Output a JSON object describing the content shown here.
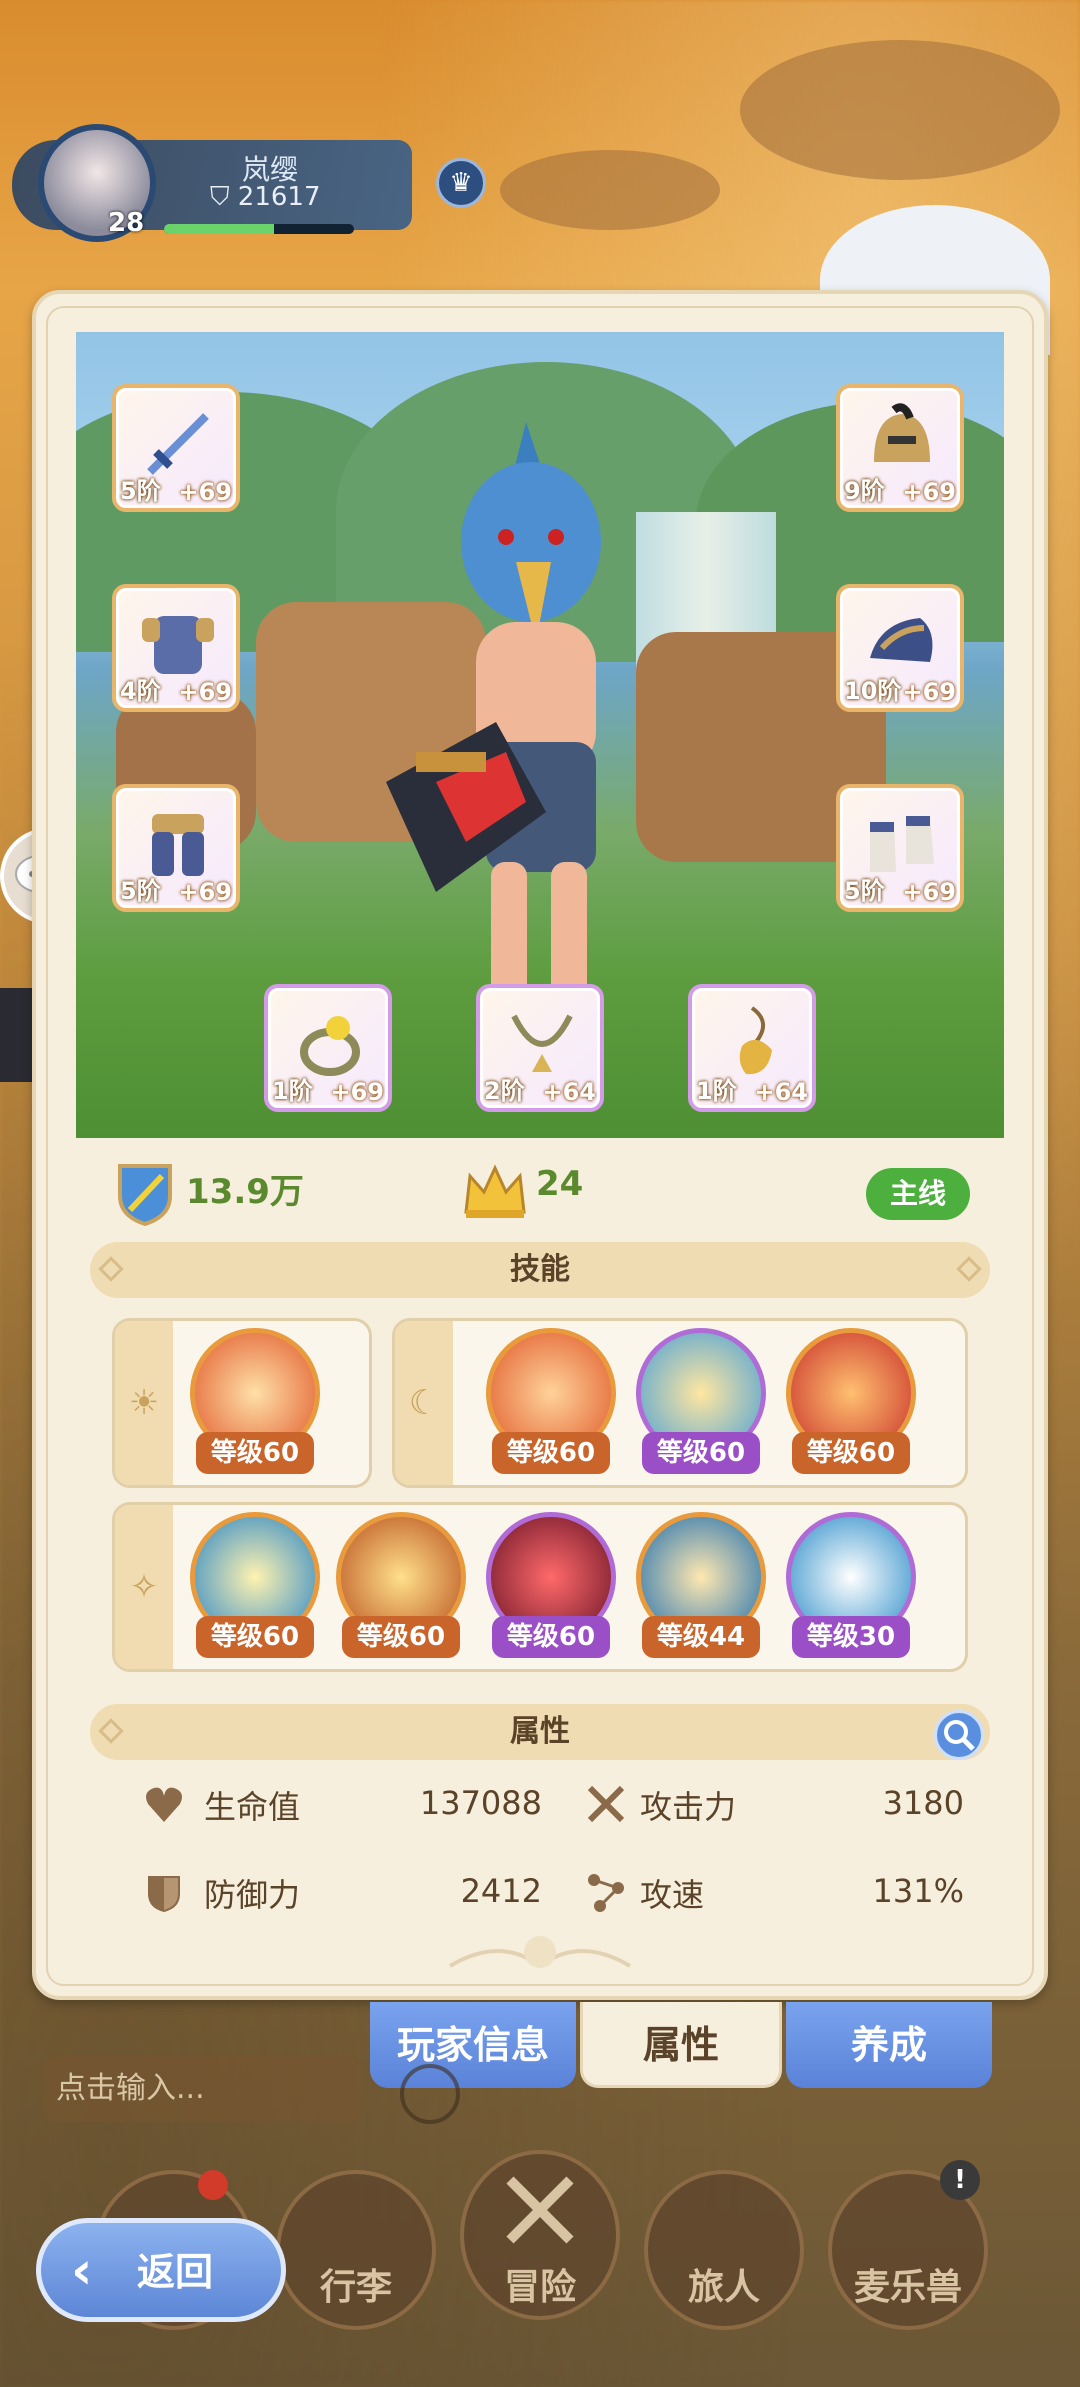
{
  "player": {
    "name": "岚缨",
    "power": "21617",
    "level": "28"
  },
  "equipment": [
    {
      "tier": "5阶",
      "plus": "+69",
      "icon": "sword-icon"
    },
    {
      "tier": "4阶",
      "plus": "+69",
      "icon": "chest-armor-icon"
    },
    {
      "tier": "5阶",
      "plus": "+69",
      "icon": "leg-armor-icon"
    },
    {
      "tier": "9阶",
      "plus": "+69",
      "icon": "helmet-icon"
    },
    {
      "tier": "10阶",
      "plus": "+69",
      "icon": "gauntlet-icon"
    },
    {
      "tier": "5阶",
      "plus": "+69",
      "icon": "boots-icon"
    },
    {
      "tier": "1阶",
      "plus": "+69",
      "icon": "ring-icon"
    },
    {
      "tier": "2阶",
      "plus": "+64",
      "icon": "necklace-icon"
    },
    {
      "tier": "1阶",
      "plus": "+64",
      "icon": "amulet-icon"
    }
  ],
  "stats": {
    "combat_power": "13.9万",
    "crown_level": "24",
    "mainline_label": "主线"
  },
  "sections": {
    "skills": "技能",
    "attributes": "属性"
  },
  "skills": {
    "group_a": [
      {
        "level": "等级60"
      }
    ],
    "group_b": [
      {
        "level": "等级60"
      },
      {
        "level": "等级60"
      },
      {
        "level": "等级60"
      }
    ],
    "group_c": [
      {
        "level": "等级60"
      },
      {
        "level": "等级60"
      },
      {
        "level": "等级60"
      },
      {
        "level": "等级44"
      },
      {
        "level": "等级30"
      }
    ]
  },
  "attributes": [
    {
      "label": "生命值",
      "value": "137088"
    },
    {
      "label": "攻击力",
      "value": "3180"
    },
    {
      "label": "防御力",
      "value": "2412"
    },
    {
      "label": "攻速",
      "value": "131%"
    }
  ],
  "tabs": {
    "player_info": "玩家信息",
    "attributes": "属性",
    "cultivate": "养成"
  },
  "chat_placeholder": "点击输入...",
  "nav": {
    "bag": "行李",
    "adventure": "冒险",
    "traveler": "旅人",
    "pet": "麦乐兽"
  },
  "back_label": "返回",
  "colors": {
    "accent_blue": "#5a82d8",
    "mainline_green": "#4caf3e",
    "panel_bg": "#f7efde",
    "skill_orange": "#c9642a",
    "skill_purple": "#9b4fc7"
  }
}
